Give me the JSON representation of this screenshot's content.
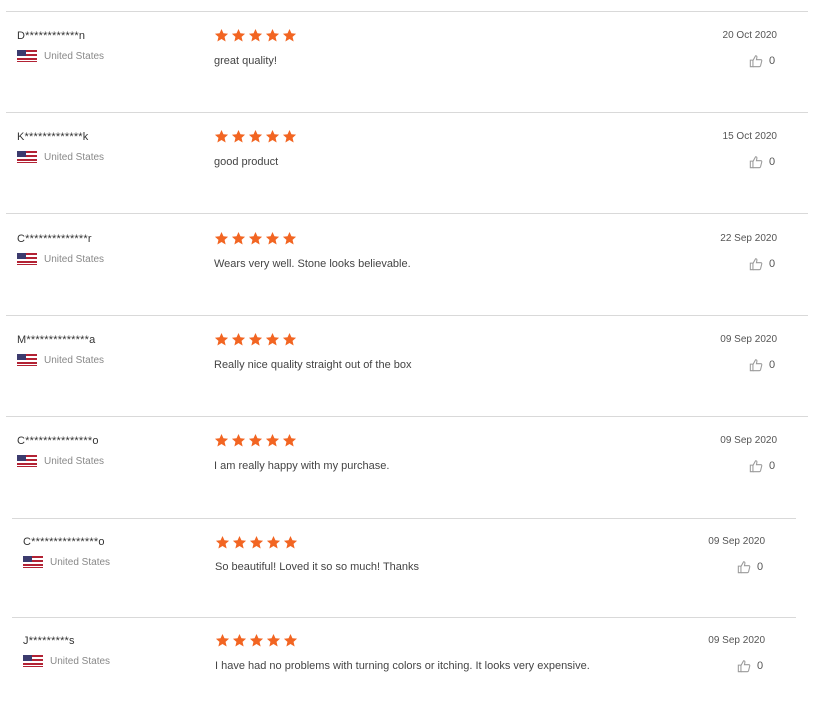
{
  "colors": {
    "star": "#f26522",
    "divider": "#d9d9d9"
  },
  "icons": {
    "flag": "us-flag-icon",
    "star": "star-icon",
    "helpful": "thumbs-up-icon"
  },
  "reviews": [
    {
      "user": "D************n",
      "country": "United States",
      "rating": 5,
      "text": "great quality!",
      "date": "20 Oct 2020",
      "helpful": "0"
    },
    {
      "user": "K*************k",
      "country": "United States",
      "rating": 5,
      "text": "good product",
      "date": "15 Oct 2020",
      "helpful": "0"
    },
    {
      "user": "C**************r",
      "country": "United States",
      "rating": 5,
      "text": "Wears very well. Stone looks believable.",
      "date": "22 Sep 2020",
      "helpful": "0"
    },
    {
      "user": "M**************a",
      "country": "United States",
      "rating": 5,
      "text": "Really nice quality straight out of the box",
      "date": "09 Sep 2020",
      "helpful": "0"
    },
    {
      "user": "C***************o",
      "country": "United States",
      "rating": 5,
      "text": "I am really happy with my purchase.",
      "date": "09 Sep 2020",
      "helpful": "0"
    },
    {
      "user": "C***************o",
      "country": "United States",
      "rating": 5,
      "text": "So beautiful! Loved it so so much! Thanks",
      "date": "09 Sep 2020",
      "helpful": "0"
    },
    {
      "user": "J*********s",
      "country": "United States",
      "rating": 5,
      "text": "I have had no problems with turning colors or itching. It looks very expensive.",
      "date": "09 Sep 2020",
      "helpful": "0"
    }
  ]
}
